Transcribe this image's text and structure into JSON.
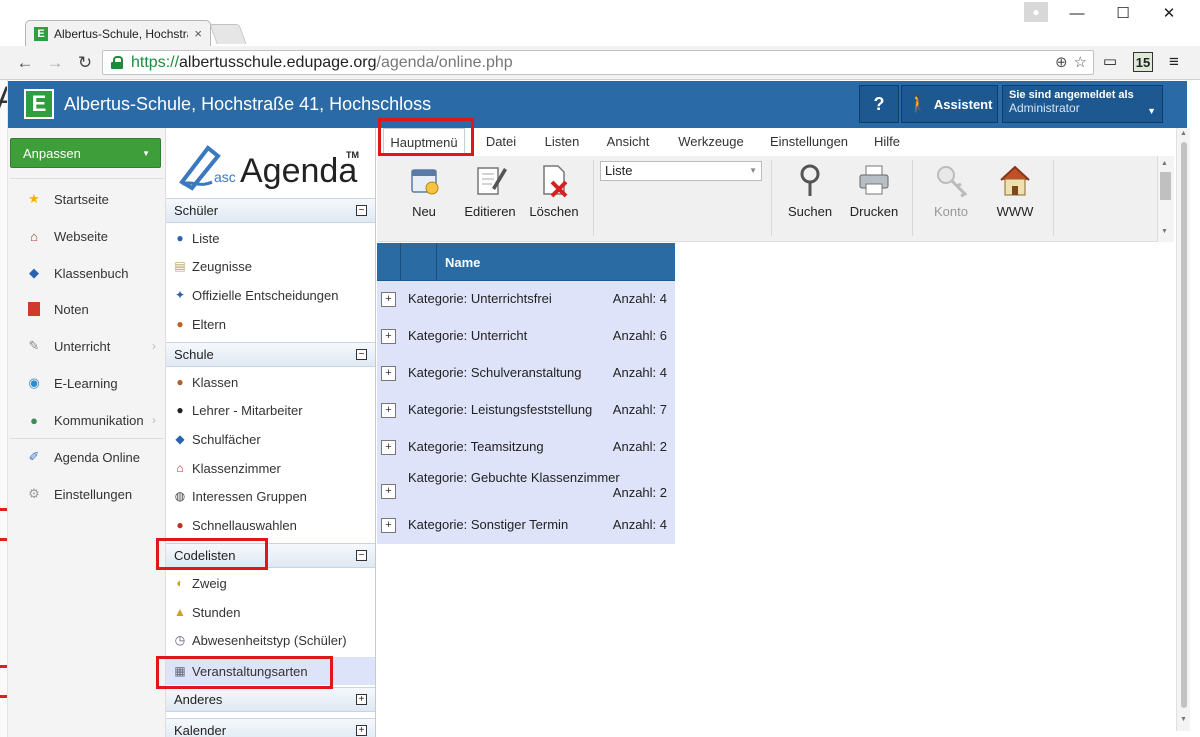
{
  "browser": {
    "tab_title": "Albertus-Schule, Hochstra",
    "tab_close": "×",
    "url_scheme": "https://",
    "url_host": "albertusschule.edupage.org",
    "url_path": "/agenda/online.php",
    "ext_badge": "15"
  },
  "header": {
    "logo_letter": "E",
    "title": "Albertus-Schule, Hochstraße 41, Hochschloss",
    "help_label": "?",
    "assistant_label": "Assistent",
    "login_label": "Sie sind angemeldet als",
    "login_user": "Administrator"
  },
  "leftnav": {
    "anpassen": "Anpassen",
    "items": [
      {
        "label": "Startseite",
        "icon": "star-icon"
      },
      {
        "label": "Webseite",
        "icon": "house-icon"
      },
      {
        "label": "Klassenbuch",
        "icon": "book-icon"
      },
      {
        "label": "Noten",
        "icon": "grades-icon"
      },
      {
        "label": "Unterricht",
        "icon": "teaching-icon"
      },
      {
        "label": "E-Learning",
        "icon": "globe-icon"
      },
      {
        "label": "Kommunikation",
        "icon": "people-icon"
      },
      {
        "label": "Agenda Online",
        "icon": "agenda-icon"
      },
      {
        "label": "Einstellungen",
        "icon": "settings-icon"
      }
    ]
  },
  "sidebar": {
    "logo_prefix": "asc",
    "logo_word": "Agenda",
    "logo_tm": "TM",
    "sections": [
      {
        "title": "Schüler",
        "toggle": "−"
      },
      {
        "title": "Schule",
        "toggle": "−"
      },
      {
        "title": "Codelisten",
        "toggle": "−"
      },
      {
        "title": "Anderes",
        "toggle": "+"
      },
      {
        "title": "Kalender",
        "toggle": "+"
      }
    ],
    "schueler_items": [
      "Liste",
      "Zeugnisse",
      "Offizielle Entscheidungen",
      "Eltern"
    ],
    "schule_items": [
      "Klassen",
      "Lehrer - Mitarbeiter",
      "Schulfächer",
      "Klassenzimmer",
      "Interessen Gruppen",
      "Schnellauswahlen"
    ],
    "codelisten_items": [
      "Zweig",
      "Stunden",
      "Abwesenheitstyp (Schüler)",
      "Veranstaltungsarten"
    ]
  },
  "menu": {
    "items": [
      "Hauptmenü",
      "Datei",
      "Listen",
      "Ansicht",
      "Werkzeuge",
      "Einstellungen",
      "Hilfe"
    ],
    "active": "Hauptmenü"
  },
  "toolbar": {
    "neu": "Neu",
    "editieren": "Editieren",
    "loeschen": "Löschen",
    "list_select": "Liste",
    "suchen": "Suchen",
    "drucken": "Drucken",
    "konto": "Konto",
    "www": "WWW"
  },
  "grid": {
    "column_name": "Name",
    "toggle": "+",
    "rows": [
      {
        "label": "Kategorie: Unterrichtsfrei",
        "count": "Anzahl: 4"
      },
      {
        "label": "Kategorie: Unterricht",
        "count": "Anzahl: 6"
      },
      {
        "label": "Kategorie: Schulveranstaltung",
        "count": "Anzahl: 4"
      },
      {
        "label": "Kategorie: Leistungsfeststellung",
        "count": "Anzahl: 7"
      },
      {
        "label": "Kategorie: Teamsitzung",
        "count": "Anzahl: 2"
      },
      {
        "label": "Kategorie: Gebuchte Klassenzimmer",
        "count": "Anzahl: 2"
      },
      {
        "label": "Kategorie: Sonstiger Termin",
        "count": "Anzahl: 4"
      }
    ]
  },
  "colors": {
    "header_blue": "#2a6aa6",
    "anpassen_green": "#3e9e3a",
    "highlight_red": "#e0161b",
    "grid_row_bg": "#dfe3fa"
  }
}
